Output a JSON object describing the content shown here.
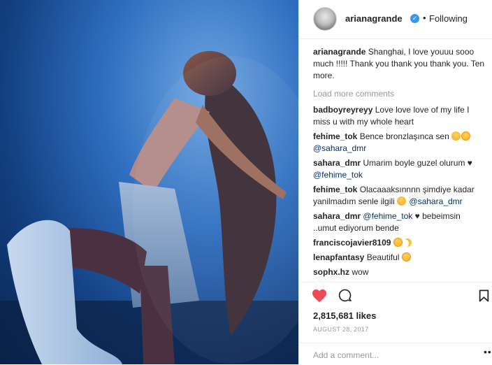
{
  "post": {
    "image_alt": "performer on stage",
    "author": "arianagrande",
    "follow_status": "Following",
    "dot": "•",
    "verified_glyph": "✓"
  },
  "caption": {
    "user": "arianagrande",
    "text": "Shanghai, I love youuu sooo much !!!!! Thank you thank you thank you. Ten more."
  },
  "load_more": "Load more comments",
  "comments": [
    {
      "user": "badboyreyreyy",
      "text": "Love love love of my life I miss u with my whole heart"
    },
    {
      "user": "fehime_tok",
      "text": "Bence bronzlaşınca sen",
      "mention": "@sahara_dmr"
    },
    {
      "user": "sahara_dmr",
      "text": "Umarim boyle guzel olurum",
      "mention": "@fehime_tok"
    },
    {
      "user": "fehime_tok",
      "text": "Olacaaaksınnnn şimdiye kadar yanilmadım senle ilgili",
      "mention": "@sahara_dmr"
    },
    {
      "user": "sahara_dmr",
      "mention": "@fehime_tok",
      "text": "bebeimsin ..umut ediyorum bende"
    },
    {
      "user": "franciscojavier8109",
      "text": ""
    },
    {
      "user": "lenapfantasy",
      "text": "Beautiful"
    },
    {
      "user": "sophx.hz",
      "text": "wow"
    }
  ],
  "icons": {
    "like": "heart-icon",
    "comment": "comment-icon",
    "save": "bookmark-icon",
    "more": "more-options-icon"
  },
  "colors": {
    "like": "#ed4956",
    "mention": "#003569",
    "verified": "#3897f0",
    "muted": "#999999"
  },
  "likes": "2,815,681 likes",
  "date": "AUGUST 28, 2017",
  "add_comment": {
    "placeholder": "Add a comment..."
  },
  "more_dots": "•••"
}
